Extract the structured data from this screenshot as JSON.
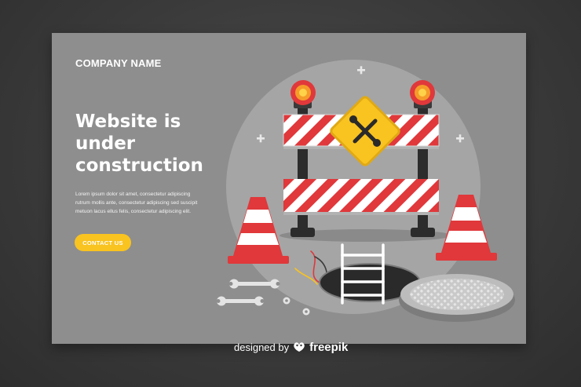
{
  "company_name": "COMPANY NAME",
  "headline": {
    "line1": "Website is",
    "line2": "under",
    "line3": "construction"
  },
  "body_text": {
    "line1": "Lorem ipsum dolor sit amet, consectetur adipiscing",
    "line2": "rutrum mollis ante, consectetur adipiscing sed suscipit",
    "line3": "metuon lacus ellus felis, consectetur adipiscing elit."
  },
  "cta_label": "CONTACT US",
  "credit": {
    "prefix": "designed by",
    "brand": "freepik"
  },
  "colors": {
    "card_bg": "#8e8e8e",
    "accent_yellow": "#f9c320",
    "stripe_red": "#e0383b",
    "background_dark": "#333333"
  },
  "icons": [
    "plus-sparkle-icon",
    "warning-light-icon",
    "wrench-cross-sign-icon",
    "traffic-cone-icon",
    "manhole-cover-icon",
    "wrench-icon",
    "nut-icon",
    "freepik-logo-icon"
  ]
}
